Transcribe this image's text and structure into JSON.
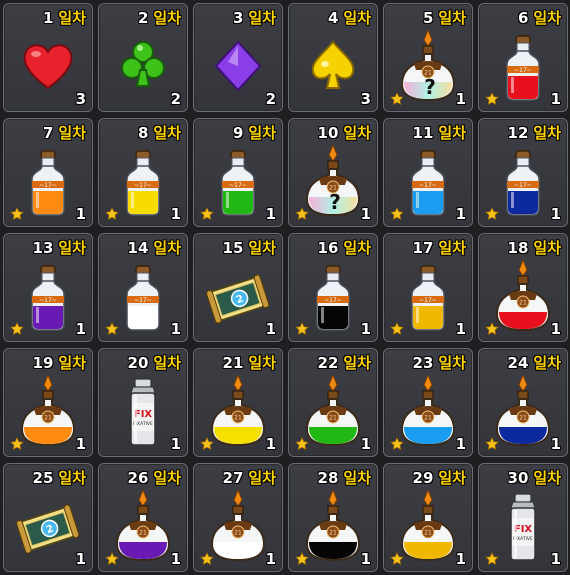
{
  "day_suffix": "일차",
  "items": [
    {
      "day": "1",
      "count": "3",
      "type": "heart",
      "star": false
    },
    {
      "day": "2",
      "count": "2",
      "type": "club",
      "star": false
    },
    {
      "day": "3",
      "count": "2",
      "type": "diamond",
      "star": false
    },
    {
      "day": "4",
      "count": "3",
      "type": "spade",
      "star": false
    },
    {
      "day": "5",
      "count": "1",
      "type": "mystery-flask",
      "star": true
    },
    {
      "day": "6",
      "count": "1",
      "type": "bottle",
      "color": "#e8101c",
      "star": true
    },
    {
      "day": "7",
      "count": "1",
      "type": "bottle",
      "color": "#ff8a12",
      "star": true
    },
    {
      "day": "8",
      "count": "1",
      "type": "bottle",
      "color": "#f6dc00",
      "star": true
    },
    {
      "day": "9",
      "count": "1",
      "type": "bottle",
      "color": "#22b814",
      "star": true
    },
    {
      "day": "10",
      "count": "1",
      "type": "mystery-flask",
      "star": true
    },
    {
      "day": "11",
      "count": "1",
      "type": "bottle",
      "color": "#1a9cf0",
      "star": true
    },
    {
      "day": "12",
      "count": "1",
      "type": "bottle",
      "color": "#0c2a9e",
      "star": true
    },
    {
      "day": "13",
      "count": "1",
      "type": "bottle",
      "color": "#6a1ab4",
      "star": true
    },
    {
      "day": "14",
      "count": "1",
      "type": "bottle",
      "color": "#ffffff",
      "star": true
    },
    {
      "day": "15",
      "count": "1",
      "type": "scroll",
      "star": false
    },
    {
      "day": "16",
      "count": "1",
      "type": "bottle",
      "color": "#050505",
      "star": true
    },
    {
      "day": "17",
      "count": "1",
      "type": "bottle",
      "color": "#f0b800",
      "star": true
    },
    {
      "day": "18",
      "count": "1",
      "type": "flask",
      "color": "#e8101c",
      "star": true
    },
    {
      "day": "19",
      "count": "1",
      "type": "flask",
      "color": "#ff8a12",
      "star": true
    },
    {
      "day": "20",
      "count": "1",
      "type": "spray",
      "star": false
    },
    {
      "day": "21",
      "count": "1",
      "type": "flask",
      "color": "#f6e000",
      "star": true
    },
    {
      "day": "22",
      "count": "1",
      "type": "flask",
      "color": "#22b814",
      "star": true
    },
    {
      "day": "23",
      "count": "1",
      "type": "flask",
      "color": "#1a9cf0",
      "star": true
    },
    {
      "day": "24",
      "count": "1",
      "type": "flask",
      "color": "#0c2a9e",
      "star": true
    },
    {
      "day": "25",
      "count": "1",
      "type": "scroll",
      "star": false
    },
    {
      "day": "26",
      "count": "1",
      "type": "flask",
      "color": "#6a1ab4",
      "star": true
    },
    {
      "day": "27",
      "count": "1",
      "type": "flask",
      "color": "#ffffff",
      "star": true
    },
    {
      "day": "28",
      "count": "1",
      "type": "flask",
      "color": "#050505",
      "star": true
    },
    {
      "day": "29",
      "count": "1",
      "type": "flask",
      "color": "#f0b800",
      "star": true
    },
    {
      "day": "30",
      "count": "1",
      "type": "spray",
      "star": true
    }
  ],
  "label_text": {
    "flask_number": "21",
    "mystery_mark": "?",
    "spray_brand": "FIX",
    "spray_sub": "FIXATIVE"
  }
}
